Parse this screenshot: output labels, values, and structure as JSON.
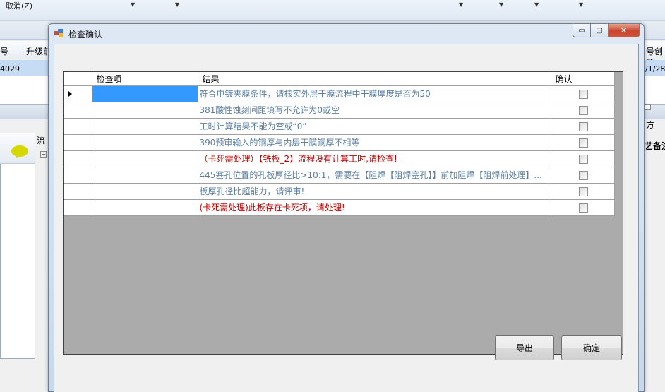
{
  "background": {
    "menu_cancel": "取消(Z)",
    "grid_header_1": "号",
    "grid_header_2": "升级前",
    "grid_header_right": "号创建",
    "row_left_value": "4029",
    "row_right_value": "/1/28",
    "flow_label": "流",
    "right_tab": "方",
    "right_label": "艺备注"
  },
  "dialog": {
    "title": "检查确认",
    "window_buttons": {
      "minimize": "▭",
      "maximize": "▢",
      "close": "✕"
    },
    "columns": {
      "item": "检查项",
      "result": "结果",
      "confirm": "确认"
    },
    "rows": [
      {
        "item": "",
        "result": "符合电镀夹膜条件，请核实外层干膜流程中干膜厚度是否为50",
        "color": "blue",
        "confirmed": false
      },
      {
        "item": "",
        "result": "381酸性蚀刻间距填写不允许为0或空",
        "color": "blue",
        "confirmed": false
      },
      {
        "item": "",
        "result": "工时计算结果不能为空或“0”",
        "color": "blue",
        "confirmed": false
      },
      {
        "item": "",
        "result": "390预审输入的铜厚与内层干膜铜厚不相等",
        "color": "blue",
        "confirmed": false
      },
      {
        "item": "",
        "result": "（卡死需处理）【铣板_2】流程没有计算工时,请检查!",
        "color": "red",
        "confirmed": false
      },
      {
        "item": "",
        "result": "445塞孔位置的孔板厚径比>10:1，需要在【阻焊【阻焊塞孔】】前加阻焊【阻焊前处理】...",
        "color": "blue",
        "confirmed": false
      },
      {
        "item": "",
        "result": "板厚孔径比超能力，请评审!",
        "color": "blue",
        "confirmed": false
      },
      {
        "item": "",
        "result": "(卡死需处理)此板存在卡死项，请处理!",
        "color": "red",
        "confirmed": false
      }
    ],
    "buttons": {
      "export": "导出",
      "ok": "确定"
    }
  }
}
